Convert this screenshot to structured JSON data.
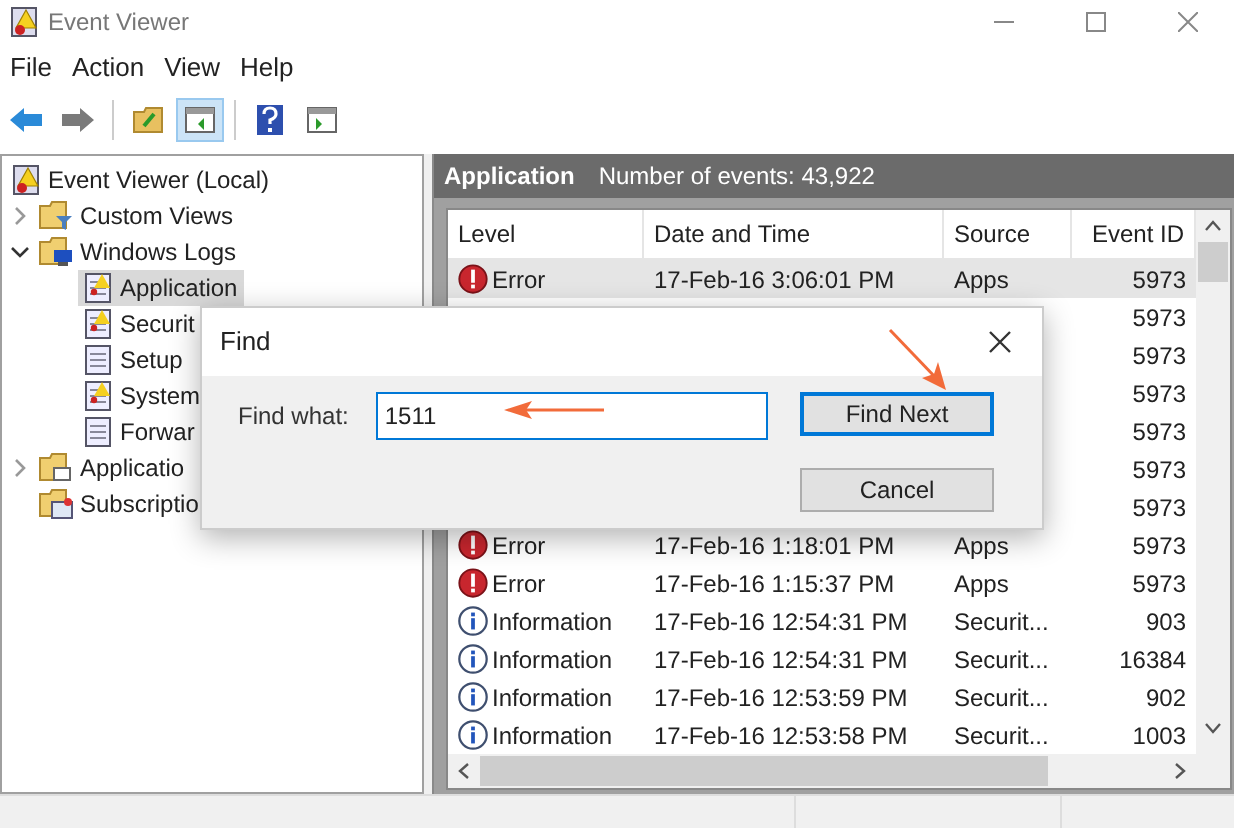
{
  "window": {
    "title": "Event Viewer"
  },
  "menu": [
    "File",
    "Action",
    "View",
    "Help"
  ],
  "toolbar": [
    {
      "kind": "back",
      "pressed": false
    },
    {
      "kind": "forward",
      "pressed": false
    },
    {
      "kind": "sep"
    },
    {
      "kind": "folder",
      "pressed": false
    },
    {
      "kind": "pane",
      "pressed": true
    },
    {
      "kind": "sep"
    },
    {
      "kind": "help",
      "pressed": false
    },
    {
      "kind": "pane2",
      "pressed": false
    }
  ],
  "tree": [
    {
      "label": "Event Viewer (Local)",
      "kind": "viewer",
      "selected": false,
      "children": [
        {
          "label": "Custom Views",
          "kind": "filter",
          "expanded": false,
          "selected": false
        },
        {
          "label": "Windows Logs",
          "kind": "pc",
          "expanded": true,
          "selected": false,
          "children": [
            {
              "label": "Application",
              "kind": "log_warn",
              "selected": true
            },
            {
              "label": "Securit",
              "kind": "log_warn",
              "selected": false
            },
            {
              "label": "Setup",
              "kind": "log",
              "selected": false
            },
            {
              "label": "System",
              "kind": "log_warn",
              "selected": false
            },
            {
              "label": "Forwar",
              "kind": "log",
              "selected": false
            }
          ]
        },
        {
          "label": "Applicatio",
          "kind": "folder",
          "expanded": false,
          "selected": false
        },
        {
          "label": "Subscriptio",
          "kind": "subs",
          "selected": false
        }
      ]
    }
  ],
  "panel": {
    "title": "Application",
    "count": "Number of events: 43,922"
  },
  "table": {
    "columns": [
      "Level",
      "Date and Time",
      "Source",
      "Event ID"
    ],
    "rows": [
      {
        "kind": "error",
        "level": "Error",
        "date": "17-Feb-16 3:06:01 PM",
        "source": "Apps",
        "event_id": "5973",
        "selected": true
      },
      {
        "event_id": "5973",
        "selected": false
      },
      {
        "event_id": "5973",
        "selected": false
      },
      {
        "event_id": "5973",
        "selected": false
      },
      {
        "event_id": "5973",
        "selected": false
      },
      {
        "event_id": "5973",
        "selected": false
      },
      {
        "event_id": "5973",
        "selected": false
      },
      {
        "kind": "error",
        "level": "Error",
        "date": "17-Feb-16 1:18:01 PM",
        "source": "Apps",
        "event_id": "5973",
        "selected": false
      },
      {
        "kind": "error",
        "level": "Error",
        "date": "17-Feb-16 1:15:37 PM",
        "source": "Apps",
        "event_id": "5973",
        "selected": false
      },
      {
        "kind": "info",
        "level": "Information",
        "date": "17-Feb-16 12:54:31 PM",
        "source": "Securit...",
        "event_id": "903",
        "selected": false
      },
      {
        "kind": "info",
        "level": "Information",
        "date": "17-Feb-16 12:54:31 PM",
        "source": "Securit...",
        "event_id": "16384",
        "selected": false
      },
      {
        "kind": "info",
        "level": "Information",
        "date": "17-Feb-16 12:53:59 PM",
        "source": "Securit...",
        "event_id": "902",
        "selected": false
      },
      {
        "kind": "info",
        "level": "Information",
        "date": "17-Feb-16 12:53:58 PM",
        "source": "Securit...",
        "event_id": "1003",
        "selected": false
      }
    ]
  },
  "dialog": {
    "title": "Find",
    "label": "Find what:",
    "value": "1511",
    "buttons": [
      {
        "label": "Find Next",
        "default": true
      },
      {
        "label": "Cancel",
        "default": false
      }
    ]
  }
}
